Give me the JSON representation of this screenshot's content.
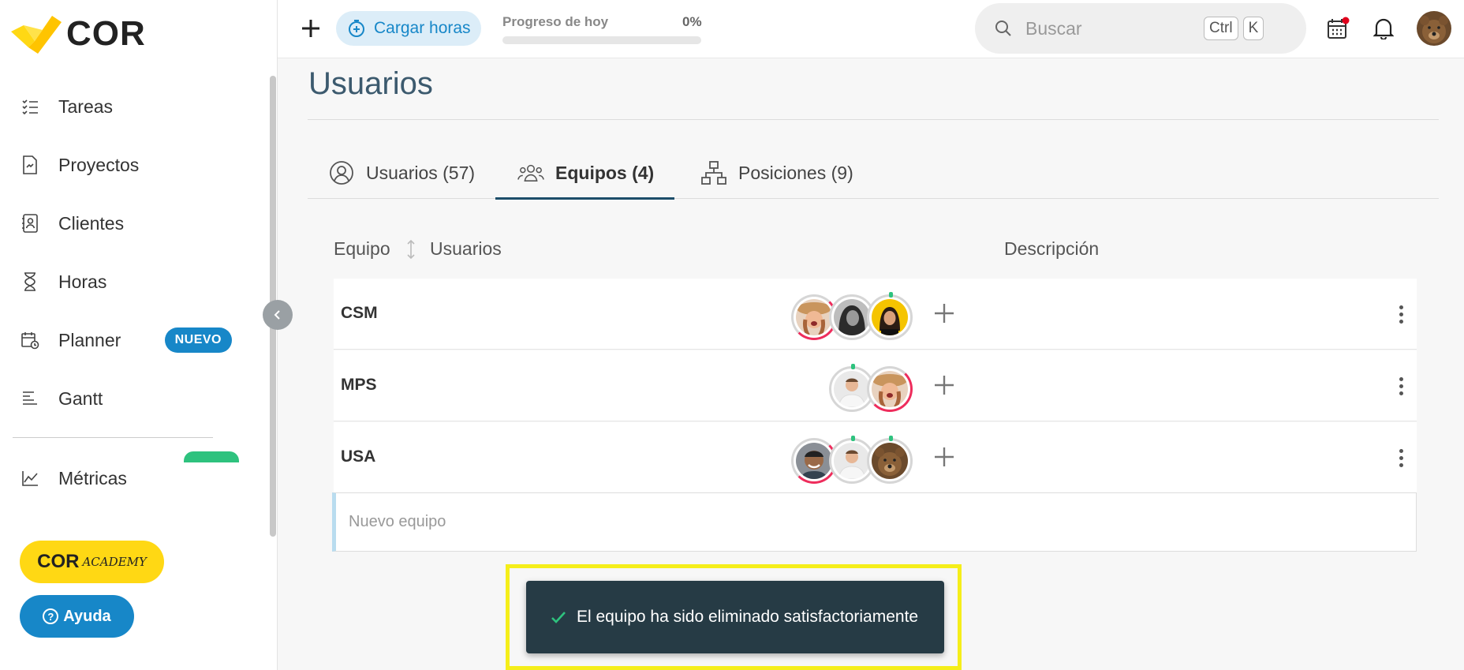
{
  "app": {
    "logo_text": "COR"
  },
  "sidebar": {
    "items": [
      {
        "label": "Tareas",
        "icon": "task-list-icon"
      },
      {
        "label": "Proyectos",
        "icon": "project-file-icon"
      },
      {
        "label": "Clientes",
        "icon": "client-contact-icon"
      },
      {
        "label": "Horas",
        "icon": "hourglass-icon"
      },
      {
        "label": "Planner",
        "icon": "calendar-clock-icon",
        "badge": "NUEVO"
      },
      {
        "label": "Gantt",
        "icon": "gantt-icon"
      },
      {
        "label": "Métricas",
        "icon": "metrics-chart-icon"
      }
    ],
    "academy": {
      "brand": "COR",
      "sub": "ACADEMY"
    },
    "help_label": "Ayuda"
  },
  "topbar": {
    "cargar_label": "Cargar horas",
    "progress_label": "Progreso de hoy",
    "progress_pct": "0%",
    "progress_value": 0,
    "search_placeholder": "Buscar",
    "kbd_ctrl": "Ctrl",
    "kbd_k": "K"
  },
  "page": {
    "title": "Usuarios",
    "tabs": [
      {
        "label": "Usuarios (57)",
        "icon": "user-circle-icon"
      },
      {
        "label": "Equipos (4)",
        "icon": "team-users-icon",
        "active": true
      },
      {
        "label": "Posiciones (9)",
        "icon": "org-chart-icon"
      }
    ],
    "columns": {
      "team": "Equipo",
      "users": "Usuarios",
      "description": "Descripción"
    },
    "teams": [
      {
        "name": "CSM",
        "description": ""
      },
      {
        "name": "MPS",
        "description": ""
      },
      {
        "name": "USA",
        "description": ""
      }
    ],
    "new_team_placeholder": "Nuevo equipo"
  },
  "toast": {
    "message": "El equipo ha sido eliminado satisfactoriamente"
  },
  "colors": {
    "primary": "#1787c8",
    "title": "#3c5a6e",
    "accent_yellow": "#ffd814",
    "toast_bg": "#263b45",
    "busy_ring": "#ee2d5c",
    "available_dot": "#2ec27e"
  }
}
